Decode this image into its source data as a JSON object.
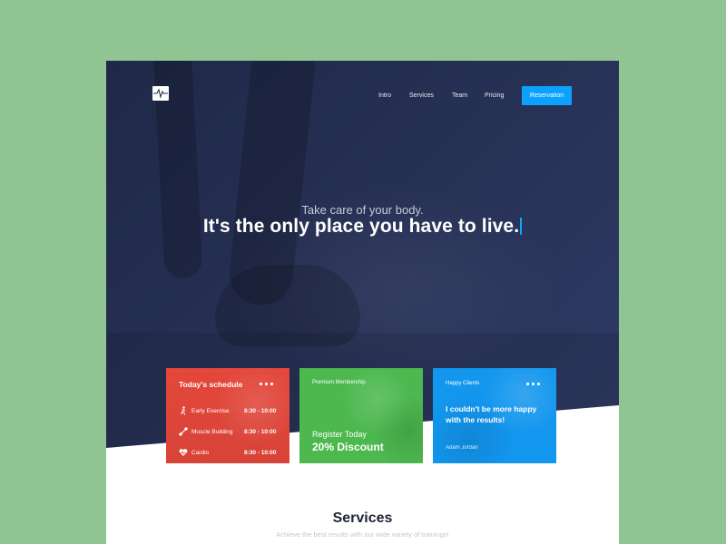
{
  "nav": {
    "logo_icon": "heartbeat-icon",
    "items": [
      "Intro",
      "Services",
      "Team",
      "Pricing"
    ],
    "cta": "Reservation"
  },
  "hero": {
    "tagline": "Take care of your body.",
    "headline": "It's the only place you have to live."
  },
  "cards": {
    "schedule": {
      "title": "Today's schedule",
      "rows": [
        {
          "icon": "runner-icon",
          "name": "Early Exercise",
          "time": "8:30 - 10:00"
        },
        {
          "icon": "dumbbell-icon",
          "name": "Muscle Building",
          "time": "8:30 - 10:00"
        },
        {
          "icon": "heart-pulse-icon",
          "name": "Cardio",
          "time": "8:30 - 10:00"
        }
      ]
    },
    "membership": {
      "label": "Premium Membership",
      "register": "Register Today",
      "discount": "20% Discount"
    },
    "clients": {
      "label": "Happy Clients",
      "quote": "I couldn't be more happy with the results!",
      "author": "Adam Jordan"
    }
  },
  "services": {
    "title": "Services",
    "subtitle": "Achieve the best results with our wide variety of trainings!"
  },
  "colors": {
    "page_bg": "#90c493",
    "hero_bg": "#262f52",
    "accent": "#0ba2ff",
    "card_red": "#f04b3e",
    "card_green": "#4cb84e",
    "card_blue": "#1296ee"
  }
}
